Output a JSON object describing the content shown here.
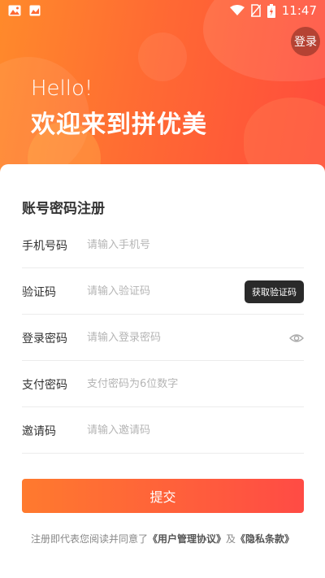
{
  "status_bar": {
    "time": "11:47"
  },
  "header": {
    "login_label": "登录",
    "hello": "Hello!",
    "welcome": "欢迎来到拼优美"
  },
  "form": {
    "title": "账号密码注册",
    "fields": [
      {
        "label": "手机号码",
        "placeholder": "请输入手机号"
      },
      {
        "label": "验证码",
        "placeholder": "请输入验证码",
        "action": "获取验证码"
      },
      {
        "label": "登录密码",
        "placeholder": "请输入登录密码",
        "icon": "eye-icon"
      },
      {
        "label": "支付密码",
        "placeholder": "支付密码为6位数字"
      },
      {
        "label": "邀请码",
        "placeholder": "请输入邀请码"
      }
    ],
    "submit_label": "提交"
  },
  "agreement": {
    "prefix": "注册即代表您阅读并同意了",
    "user_agreement": "《用户管理协议》",
    "joiner": "及",
    "privacy": "《隐私条款》"
  },
  "colors": {
    "gradient_start": "#ff8a2b",
    "gradient_end": "#ff4b3d",
    "code_button_bg": "#2a2a2a"
  }
}
